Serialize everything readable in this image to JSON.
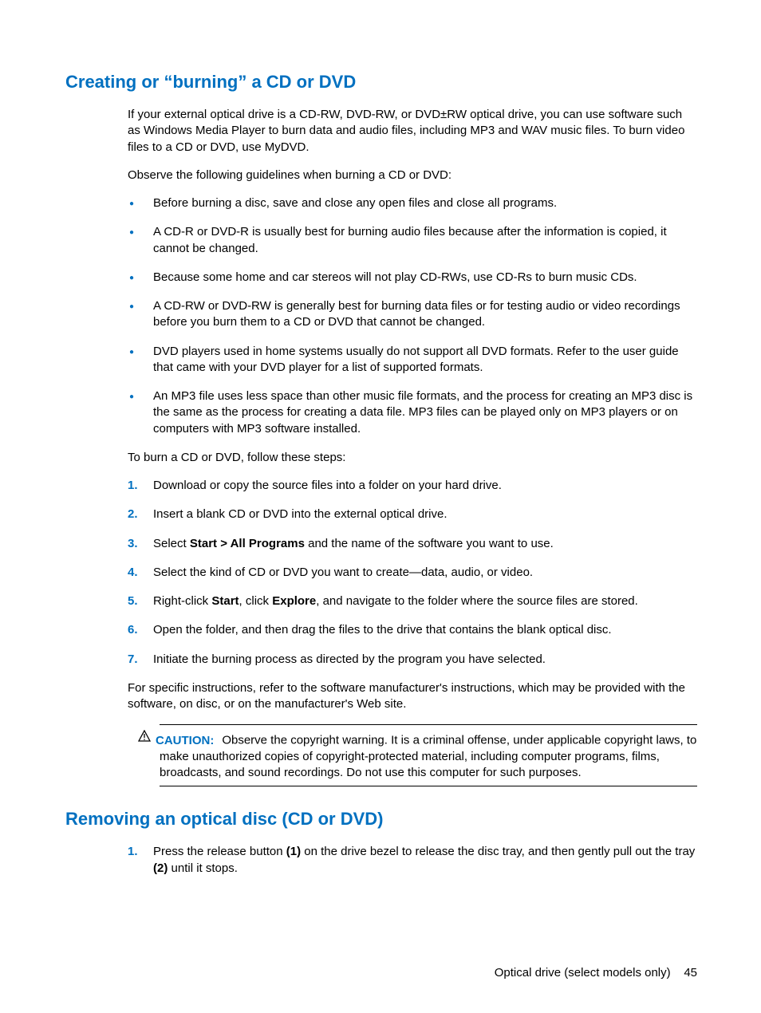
{
  "section1": {
    "heading": "Creating or “burning” a CD or DVD",
    "para1": "If your external optical drive is a CD-RW, DVD-RW, or DVD±RW optical drive, you can use software such as Windows Media Player to burn data and audio files, including MP3 and WAV music files. To burn video files to a CD or DVD, use MyDVD.",
    "para2": "Observe the following guidelines when burning a CD or DVD:",
    "bullets": [
      "Before burning a disc, save and close any open files and close all programs.",
      "A CD-R or DVD-R is usually best for burning audio files because after the information is copied, it cannot be changed.",
      "Because some home and car stereos will not play CD-RWs, use CD-Rs to burn music CDs.",
      "A CD-RW or DVD-RW is generally best for burning data files or for testing audio or video recordings before you burn them to a CD or DVD that cannot be changed.",
      "DVD players used in home systems usually do not support all DVD formats. Refer to the user guide that came with your DVD player for a list of supported formats.",
      "An MP3 file uses less space than other music file formats, and the process for creating an MP3 disc is the same as the process for creating a data file. MP3 files can be played only on MP3 players or on computers with MP3 software installed."
    ],
    "para3": "To burn a CD or DVD, follow these steps:",
    "steps": {
      "1": "Download or copy the source files into a folder on your hard drive.",
      "2": "Insert a blank CD or DVD into the external optical drive.",
      "3_pre": "Select ",
      "3_bold": "Start > All Programs",
      "3_post": " and the name of the software you want to use.",
      "4": "Select the kind of CD or DVD you want to create—data, audio, or video.",
      "5_pre": "Right-click ",
      "5_b1": "Start",
      "5_mid": ", click ",
      "5_b2": "Explore",
      "5_post": ", and navigate to the folder where the source files are stored.",
      "6": "Open the folder, and then drag the files to the drive that contains the blank optical disc.",
      "7": "Initiate the burning process as directed by the program you have selected."
    },
    "para4": "For specific instructions, refer to the software manufacturer's instructions, which may be provided with the software, on disc, or on the manufacturer's Web site.",
    "caution_label": "CAUTION:",
    "caution_text": "Observe the copyright warning. It is a criminal offense, under applicable copyright laws, to make unauthorized copies of copyright-protected material, including computer programs, films, broadcasts, and sound recordings. Do not use this computer for such purposes."
  },
  "section2": {
    "heading": "Removing an optical disc (CD or DVD)",
    "step1_pre": "Press the release button ",
    "step1_b1": "(1)",
    "step1_mid": " on the drive bezel to release the disc tray, and then gently pull out the tray ",
    "step1_b2": "(2)",
    "step1_post": " until it stops."
  },
  "footer": {
    "text": "Optical drive (select models only)",
    "page": "45"
  }
}
